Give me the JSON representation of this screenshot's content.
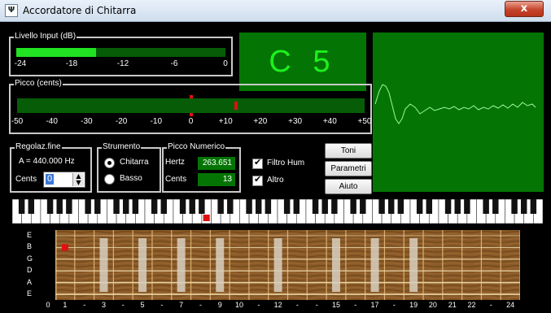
{
  "window": {
    "title": "Accordatore di Chitarra",
    "icon": "tuning-fork-icon",
    "close_label": "x"
  },
  "input_level": {
    "legend": "Livello Input (dB)",
    "level_fraction": 0.38,
    "ticks": [
      "-24",
      "-18",
      "-12",
      "-6",
      "0"
    ]
  },
  "note": {
    "value": "C 5"
  },
  "peak_cents": {
    "legend": "Picco (cents)",
    "marker_cents": 0,
    "indicator_cents": 13,
    "ticks": [
      "-50",
      "-40",
      "-30",
      "-20",
      "-10",
      "0",
      "+10",
      "+20",
      "+30",
      "+40",
      "+50"
    ]
  },
  "fine_tune": {
    "legend": "Regolaz.fine",
    "reference": "A = 440.000 Hz",
    "cents_label": "Cents",
    "cents_value": "0"
  },
  "instrument": {
    "legend": "Strumento",
    "options": [
      "Chitarra",
      "Basso"
    ],
    "selected": "Chitarra"
  },
  "numeric_peak": {
    "legend": "Picco Numerico",
    "hertz_label": "Hertz",
    "hertz_value": "263.651",
    "cents_label": "Cents",
    "cents_value": "13"
  },
  "filters": {
    "hum_label": "Filtro Hum",
    "hum_checked": true,
    "altro_label": "Altro",
    "altro_checked": true
  },
  "buttons": {
    "toni": "Toni",
    "parametri": "Parametri",
    "aiuto": "Aiuto"
  },
  "colors": {
    "display_green": "#047504",
    "bright_green": "#1df01d",
    "indicator_red": "#e01010",
    "wood": "#8a5a28"
  },
  "keyboard": {
    "active_white_key": 20
  },
  "fretboard": {
    "strings": [
      "E",
      "B",
      "G",
      "D",
      "A",
      "E"
    ],
    "fret_labels": [
      "0",
      "1",
      "-",
      "3",
      "-",
      "5",
      "-",
      "7",
      "-",
      "9",
      "10",
      "-",
      "12",
      "-",
      "-",
      "15",
      "-",
      "17",
      "-",
      "19",
      "20",
      "21",
      "22",
      "-",
      "24"
    ],
    "active_string": 1,
    "active_fret": 1,
    "inlay_frets": [
      3,
      5,
      7,
      9,
      12,
      15,
      17,
      19
    ]
  }
}
